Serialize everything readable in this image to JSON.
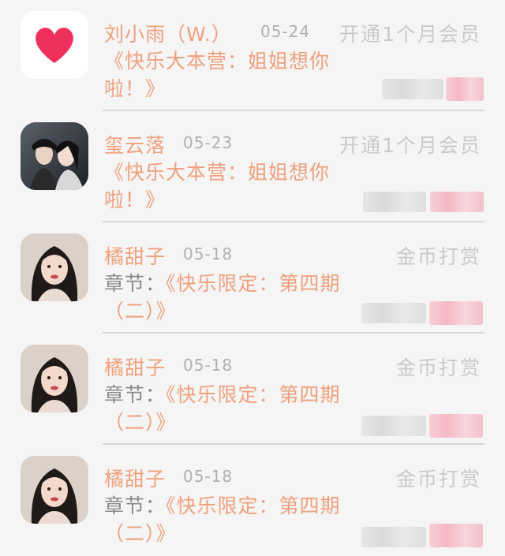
{
  "items": [
    {
      "avatar": "heart-avatar",
      "name": "刘小雨（W.）",
      "date": "05-24",
      "status": "开通1个月会员",
      "message": "《快乐大本营：姐姐想你啦！》"
    },
    {
      "avatar": "couple-photo-avatar",
      "name": "玺云落",
      "date": "05-23",
      "status": "开通1个月会员",
      "message": "《快乐大本营：姐姐想你啦！》"
    },
    {
      "avatar": "portrait-photo-avatar",
      "name": "橘甜子",
      "date": "05-18",
      "status": "金币打赏",
      "message_prefix": "章节：",
      "message": "《快乐限定：第四期（二）》"
    },
    {
      "avatar": "portrait-photo-avatar",
      "name": "橘甜子",
      "date": "05-18",
      "status": "金币打赏",
      "message_prefix": "章节：",
      "message": "《快乐限定：第四期（二）》"
    },
    {
      "avatar": "portrait-photo-avatar",
      "name": "橘甜子",
      "date": "05-18",
      "status": "金币打赏",
      "message_prefix": "章节：",
      "message": "《快乐限定：第四期（二）》"
    }
  ],
  "colors": {
    "accent": "#f0a07c",
    "muted": "#c9c9c9",
    "heart": "#f0305c"
  }
}
